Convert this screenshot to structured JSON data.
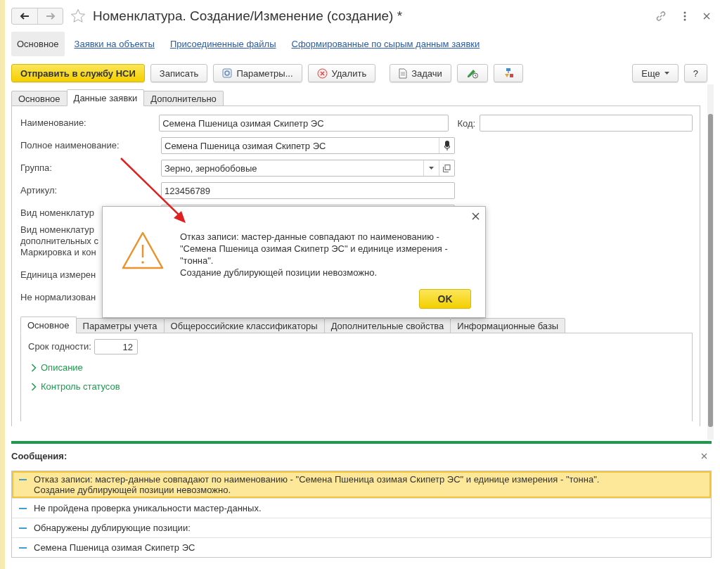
{
  "window": {
    "title": "Номенклатура. Создание/Изменение (создание) *",
    "favorite": false
  },
  "sections": [
    {
      "label": "Основное",
      "selected": true
    },
    {
      "label": "Заявки на объекты",
      "selected": false
    },
    {
      "label": "Присоединенные файлы",
      "selected": false
    },
    {
      "label": "Сформированные по сырым данным заявки",
      "selected": false
    }
  ],
  "toolbar": [
    {
      "kind": "primary",
      "label": "Отправить в службу НСИ"
    },
    {
      "kind": "plain",
      "label": "Записать"
    },
    {
      "kind": "settings",
      "label": "Параметры..."
    },
    {
      "kind": "delete",
      "label": "Удалить"
    },
    {
      "kind": "tasks",
      "label": "Задачи"
    },
    {
      "kind": "pencil"
    },
    {
      "kind": "flow"
    }
  ],
  "more": "Еще",
  "help": "?",
  "form_tabs": [
    {
      "label": "Основное",
      "selected": false
    },
    {
      "label": "Данные заявки",
      "selected": true
    },
    {
      "label": "Дополнительно",
      "selected": false
    }
  ],
  "fields": [
    {
      "label": "Наименование:",
      "kind": "text",
      "value": "Семена Пшеница озимая Скипетр ЭС",
      "side_label": "Код:"
    },
    {
      "label": "Полное наименование:",
      "kind": "voice",
      "value": "Семена Пшеница озимая Скипетр ЭС"
    },
    {
      "label": "Группа:",
      "kind": "select",
      "value": "Зерно, зернобобовые"
    },
    {
      "label": "Артикул:",
      "kind": "text",
      "value": "123456789"
    },
    {
      "label": "Вид номенклатур",
      "kind": "text"
    },
    {
      "label": "Вид номенклатур\nдополнительных с",
      "kind": "none"
    },
    {
      "label": "Маркировка и кон",
      "kind": "none"
    },
    {
      "label": "Единица измерен",
      "kind": "none"
    },
    {
      "label": "Не нормализован",
      "kind": "none"
    }
  ],
  "inner_tabs": [
    {
      "label": "Основное",
      "selected": true
    },
    {
      "label": "Параметры учета",
      "selected": false
    },
    {
      "label": "Общероссийские классификаторы",
      "selected": false
    },
    {
      "label": "Дополнительные свойства",
      "selected": false
    },
    {
      "label": "Информационные базы",
      "selected": false
    }
  ],
  "shelf_life": {
    "label": "Срок годности:",
    "value": "12"
  },
  "groups": [
    {
      "label": "Описание",
      "expanded": false
    },
    {
      "label": "Контроль статусов",
      "expanded": false
    }
  ],
  "dialog": {
    "lines": [
      "Отказ записи: мастер-данные совпадают по наименованию -",
      "\"Семена Пшеница озимая Скипетр ЭС\" и единице измерения -",
      "\"тонна\".",
      "Создание дублирующей позиции невозможно."
    ],
    "ok": "OK"
  },
  "messages": {
    "title": "Сообщения:",
    "items": [
      {
        "text": "Отказ записи: мастер-данные совпадают по наименованию - \"Семена Пшеница озимая Скипетр ЭС\" и единице измерения - \"тонна\".\nСоздание дублирующей позиции невозможно.",
        "selected": true
      },
      {
        "text": "Не пройдена проверка уникальности мастер-данных.",
        "selected": false
      },
      {
        "text": "Обнаружены дублирующие позиции:",
        "selected": false
      },
      {
        "text": "Семена Пшеница озимая Скипетр ЭС",
        "selected": false
      }
    ]
  }
}
